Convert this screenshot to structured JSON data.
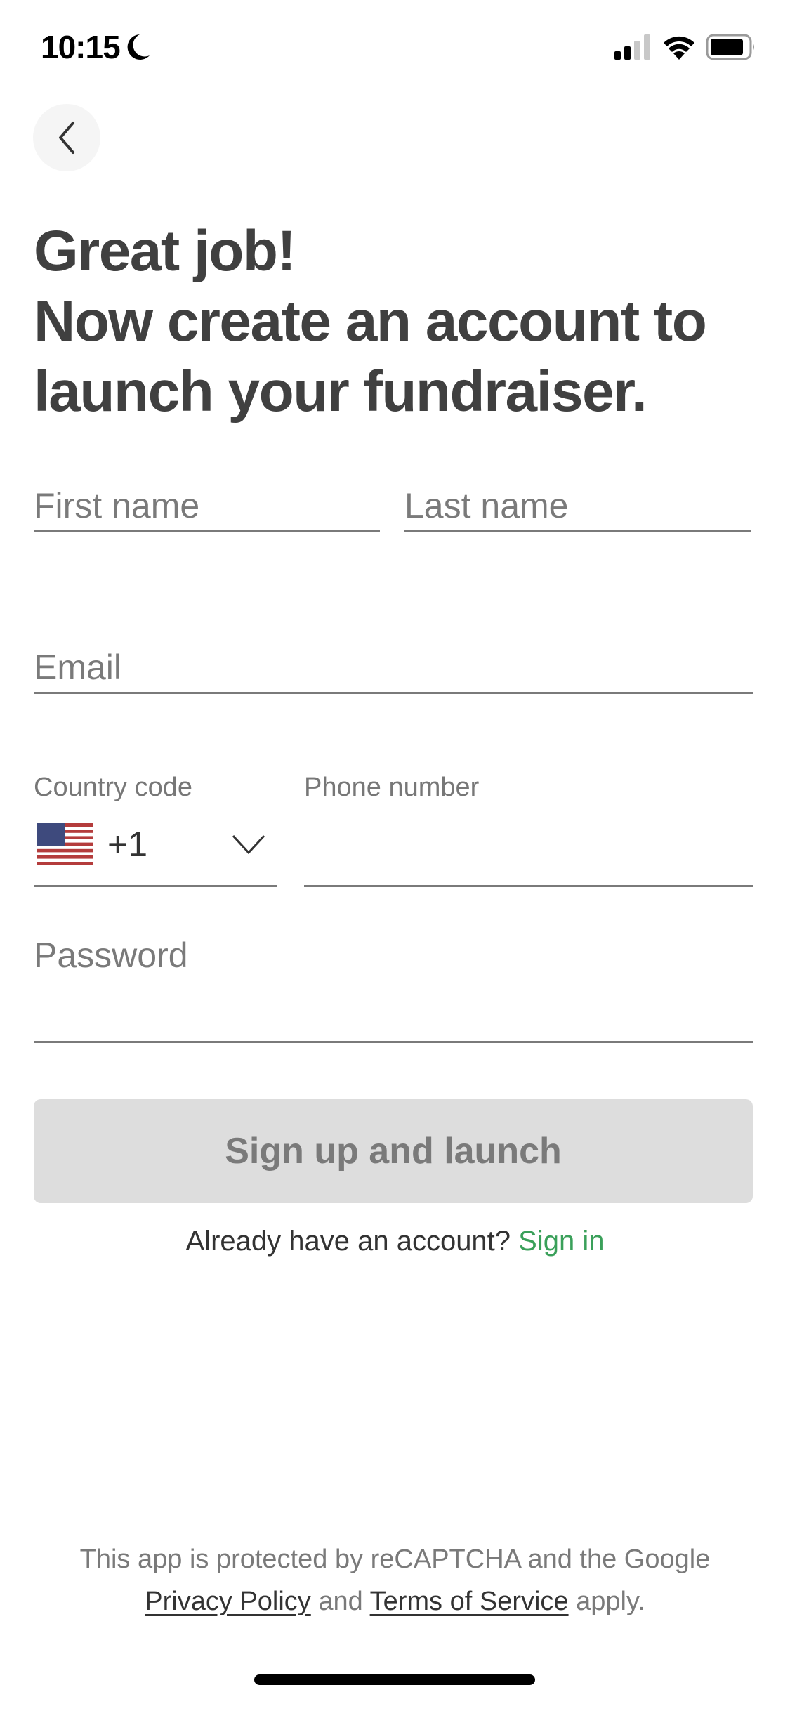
{
  "status_bar": {
    "time": "10:15",
    "focus_icon": "moon-icon",
    "signal_icon": "cellular-signal-icon",
    "wifi_icon": "wifi-icon",
    "battery_icon": "battery-icon"
  },
  "nav": {
    "back_icon": "chevron-left-icon"
  },
  "heading": {
    "line1": "Great job!",
    "line2": "Now create an account to",
    "line3": "launch your fundraiser."
  },
  "form": {
    "first_name": {
      "placeholder": "First name",
      "value": ""
    },
    "last_name": {
      "placeholder": "Last name",
      "value": ""
    },
    "email": {
      "placeholder": "Email",
      "value": ""
    },
    "country_code": {
      "label": "Country code",
      "flag": "us-flag-icon",
      "value": "+1"
    },
    "phone": {
      "label": "Phone number",
      "value": ""
    },
    "password": {
      "placeholder": "Password",
      "value": ""
    }
  },
  "submit": {
    "label": "Sign up and launch",
    "enabled": false
  },
  "signin": {
    "prompt": "Already have an account?",
    "link": "Sign in"
  },
  "footer": {
    "line1": "This app is protected by reCAPTCHA and the Google",
    "privacy_link": "Privacy Policy",
    "and": "and",
    "terms_link": "Terms of Service",
    "apply": "apply."
  },
  "colors": {
    "accent_green": "#3aa05a",
    "heading_text": "#404040",
    "disabled_button_bg": "#dddddd",
    "disabled_button_text": "#7a7a7a"
  }
}
